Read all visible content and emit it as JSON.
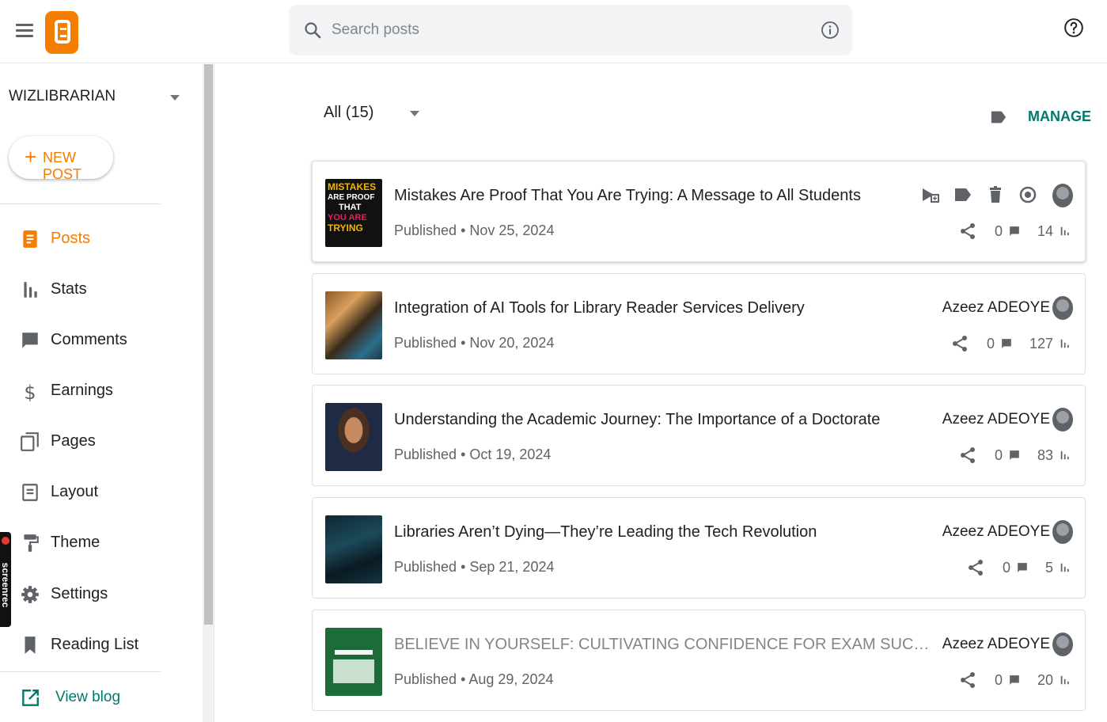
{
  "header": {
    "search_placeholder": "Search posts"
  },
  "sidebar": {
    "blog_name": "WIZLIBRARIAN",
    "new_post_label": "NEW POST",
    "items": [
      {
        "label": "Posts",
        "icon": "posts-icon"
      },
      {
        "label": "Stats",
        "icon": "stats-icon"
      },
      {
        "label": "Comments",
        "icon": "comments-icon"
      },
      {
        "label": "Earnings",
        "icon": "dollar-icon"
      },
      {
        "label": "Pages",
        "icon": "pages-icon"
      },
      {
        "label": "Layout",
        "icon": "layout-icon"
      },
      {
        "label": "Theme",
        "icon": "paint-roller-icon"
      },
      {
        "label": "Settings",
        "icon": "gear-icon"
      },
      {
        "label": "Reading List",
        "icon": "bookmark-icon"
      }
    ],
    "view_blog_label": "View blog",
    "screenrec_label": "screenrec"
  },
  "main": {
    "filter_label": "All (15)",
    "manage_label": "MANAGE",
    "posts": [
      {
        "title": "Mistakes Are Proof That You Are Trying: A Message to All Students",
        "status": "Published",
        "date": "Nov 25, 2024",
        "author": "",
        "comments": "0",
        "views": "14"
      },
      {
        "title": "Integration of AI Tools for Library Reader Services Delivery",
        "status": "Published",
        "date": "Nov 20, 2024",
        "author": "Azeez ADEOYE",
        "comments": "0",
        "views": "127"
      },
      {
        "title": "Understanding the Academic Journey: The Importance of a Doctorate",
        "status": "Published",
        "date": "Oct 19, 2024",
        "author": "Azeez ADEOYE",
        "comments": "0",
        "views": "83"
      },
      {
        "title": "Libraries Aren’t Dying—They’re Leading the Tech Revolution",
        "status": "Published",
        "date": "Sep 21, 2024",
        "author": "Azeez ADEOYE",
        "comments": "0",
        "views": "5"
      },
      {
        "title": "BELIEVE IN YOURSELF: CULTIVATING CONFIDENCE FOR EXAM SUCCESS Delivered by Azeez ...",
        "status": "Published",
        "date": "Aug 29, 2024",
        "author": "Azeez ADEOYE",
        "comments": "0",
        "views": "20"
      }
    ],
    "thumb1_text": [
      "MISTAKES",
      "ARE PROOF",
      "THAT",
      "YOU ARE",
      "TRYING"
    ]
  },
  "colors": {
    "accent": "#f57d00",
    "link": "#00796b"
  }
}
